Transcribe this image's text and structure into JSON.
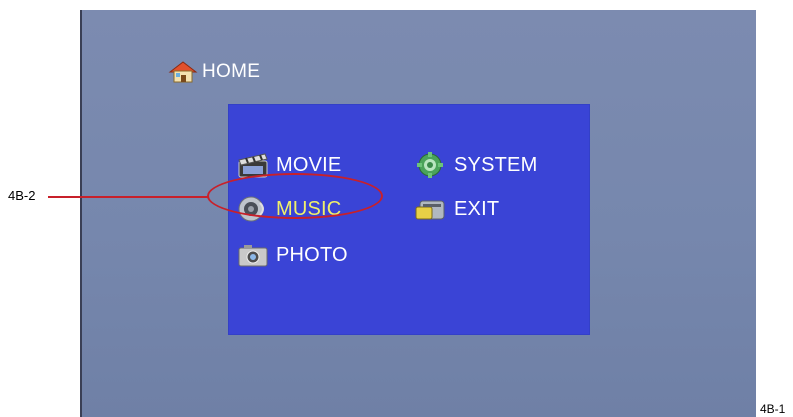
{
  "header": {
    "title": "HOME",
    "icon": "house-icon"
  },
  "menu": {
    "items": [
      {
        "label": "MOVIE",
        "icon": "film-clapper-icon",
        "selected": false
      },
      {
        "label": "MUSIC",
        "icon": "speaker-icon",
        "selected": true
      },
      {
        "label": "PHOTO",
        "icon": "camera-icon",
        "selected": false
      },
      {
        "label": "SYSTEM",
        "icon": "gear-icon",
        "selected": false
      },
      {
        "label": "EXIT",
        "icon": "exit-drive-icon",
        "selected": false
      }
    ],
    "background_color": "#3a44d6",
    "highlight_color": "#f0f06a"
  },
  "annotations": {
    "callout_label": "4B-2",
    "figure_id": "4B-1",
    "callout_color": "#c8202a"
  }
}
